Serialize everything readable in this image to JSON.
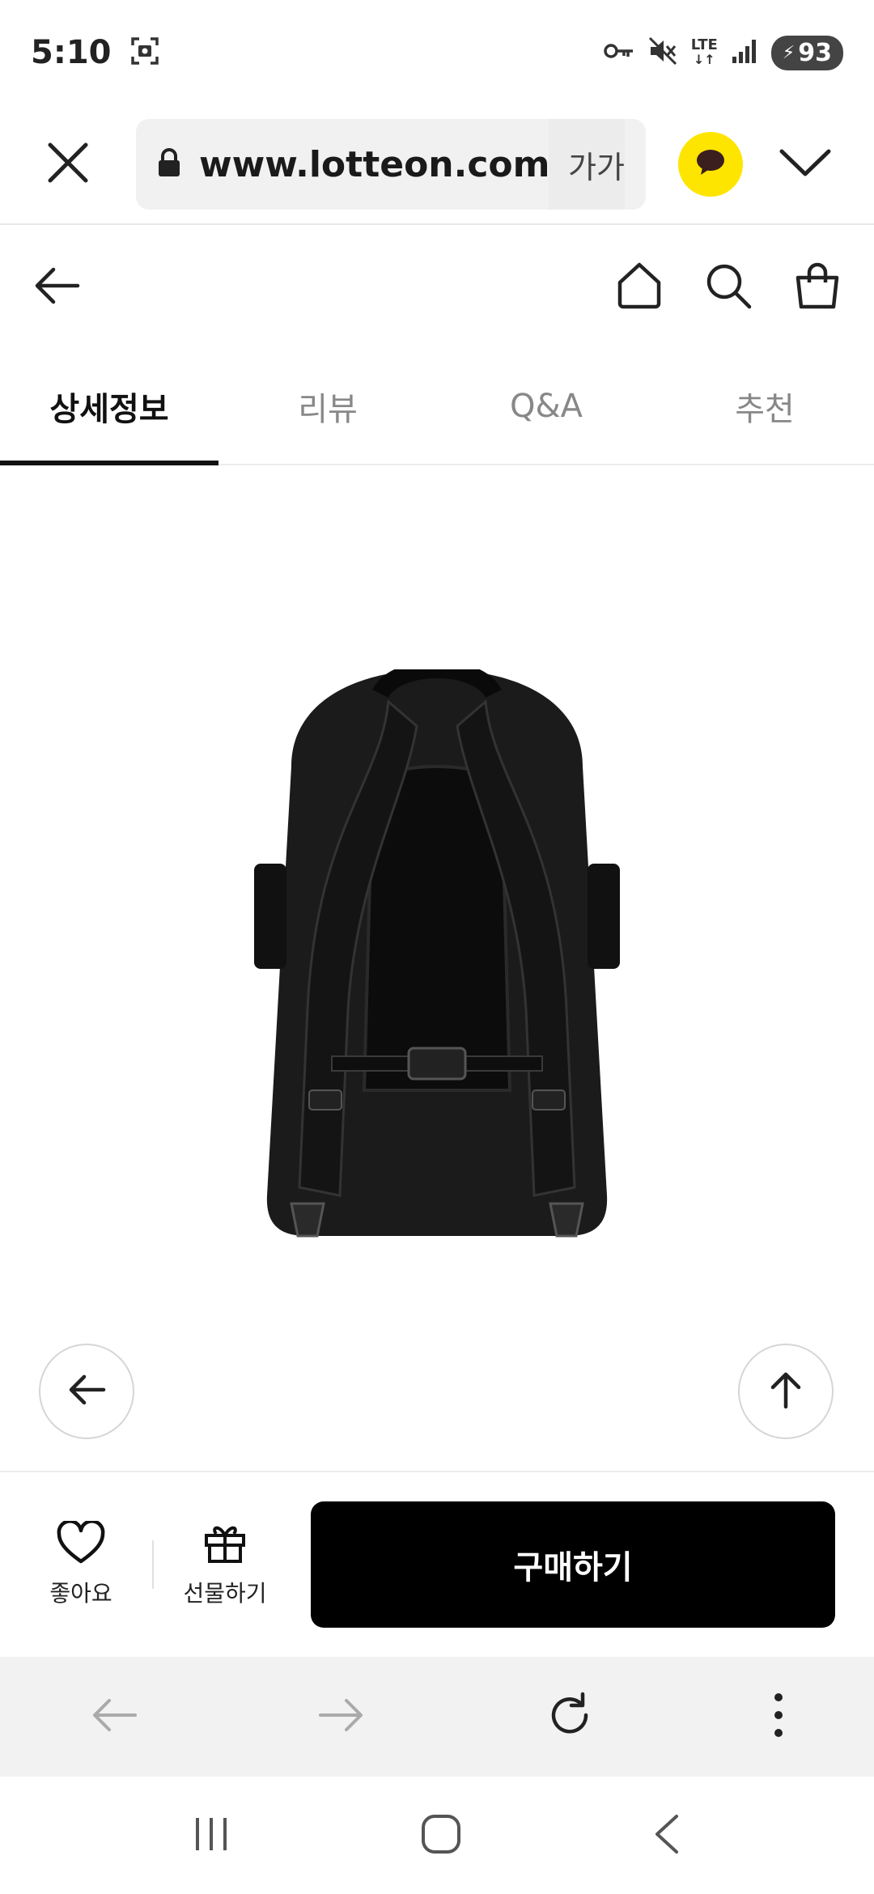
{
  "status_bar": {
    "time": "5:10",
    "network": "LTE",
    "battery": "93"
  },
  "browser": {
    "url": "www.lotteon.com",
    "font_size_label": "가가",
    "icons": [
      "close-icon",
      "lock-icon",
      "kakao-chat-icon",
      "chevron-down-icon"
    ]
  },
  "header": {
    "icons": [
      "back-arrow-icon",
      "home-icon",
      "search-icon",
      "shopping-bag-icon"
    ]
  },
  "tabs": [
    {
      "label": "상세정보",
      "active": true
    },
    {
      "label": "리뷰",
      "active": false
    },
    {
      "label": "Q&A",
      "active": false
    },
    {
      "label": "추천",
      "active": false
    }
  ],
  "product": {
    "image": "black-backpack-rear-view"
  },
  "action_bar": {
    "like_label": "좋아요",
    "gift_label": "선물하기",
    "buy_label": "구매하기"
  },
  "colors": {
    "accent": "#000000",
    "kakao": "#fee500",
    "tab_inactive": "#888888"
  }
}
